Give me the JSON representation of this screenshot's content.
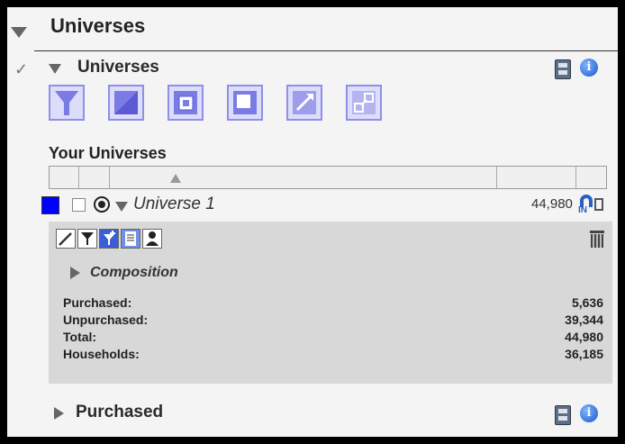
{
  "panel": {
    "title": "Universes"
  },
  "section": {
    "label": "Universes"
  },
  "toolbar": {
    "icons": [
      "filter-icon",
      "fill-icon",
      "intersect-icon",
      "combine-icon",
      "expand-icon",
      "link-icon"
    ]
  },
  "universes": {
    "heading": "Your Universes"
  },
  "row": {
    "name": "Universe 1",
    "count": "44,980",
    "color": "#0000ff"
  },
  "details": {
    "composition_label": "Composition",
    "stats": [
      {
        "label": "Purchased:",
        "value": "5,636"
      },
      {
        "label": "Unpurchased:",
        "value": "39,344"
      },
      {
        "label": "Total:",
        "value": "44,980"
      },
      {
        "label": "Households:",
        "value": "36,185"
      }
    ]
  },
  "purchased": {
    "label": "Purchased"
  }
}
